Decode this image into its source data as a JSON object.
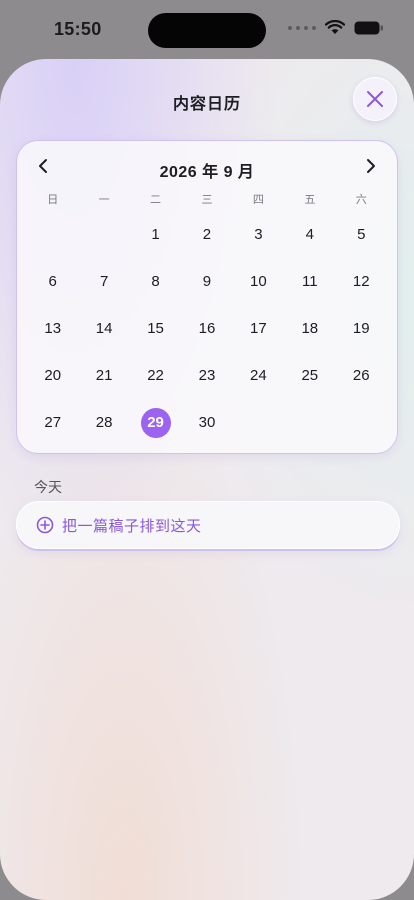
{
  "status_bar": {
    "time": "15:50"
  },
  "sheet": {
    "title": "内容日历"
  },
  "calendar": {
    "month_label": "2026 年 9 月",
    "weekdays": [
      "日",
      "一",
      "二",
      "三",
      "四",
      "五",
      "六"
    ],
    "weeks": [
      [
        "",
        "",
        "1",
        "2",
        "3",
        "4",
        "5"
      ],
      [
        "6",
        "7",
        "8",
        "9",
        "10",
        "11",
        "12"
      ],
      [
        "13",
        "14",
        "15",
        "16",
        "17",
        "18",
        "19"
      ],
      [
        "20",
        "21",
        "22",
        "23",
        "24",
        "25",
        "26"
      ],
      [
        "27",
        "28",
        "29",
        "30",
        "",
        "",
        ""
      ]
    ],
    "selected_day": "29"
  },
  "section": {
    "label": "今天"
  },
  "add_action": {
    "label": "把一篇稿子排到这天"
  },
  "icons": {
    "close": "close-icon",
    "prev": "chevron-left-icon",
    "next": "chevron-right-icon",
    "add": "plus-circle-icon"
  },
  "colors": {
    "accent": "#9b63f0",
    "accent_text": "#8a58e0"
  }
}
